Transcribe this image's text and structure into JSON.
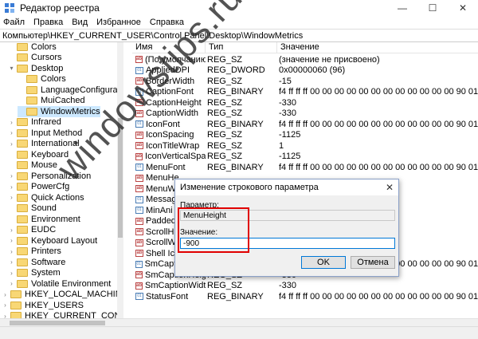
{
  "window": {
    "title": "Редактор реестра"
  },
  "menu": [
    "Файл",
    "Правка",
    "Вид",
    "Избранное",
    "Справка"
  ],
  "address": "Компьютер\\HKEY_CURRENT_USER\\Control Panel\\Desktop\\WindowMetrics",
  "tree": [
    {
      "label": "Colors",
      "level": 2,
      "twisty": ""
    },
    {
      "label": "Cursors",
      "level": 2,
      "twisty": ""
    },
    {
      "label": "Desktop",
      "level": 2,
      "twisty": "▾"
    },
    {
      "label": "Colors",
      "level": 3,
      "twisty": ""
    },
    {
      "label": "LanguageConfiguration",
      "level": 3,
      "twisty": ""
    },
    {
      "label": "MuiCached",
      "level": 3,
      "twisty": ""
    },
    {
      "label": "WindowMetrics",
      "level": 3,
      "twisty": "",
      "selected": true
    },
    {
      "label": "Infrared",
      "level": 2,
      "twisty": "›"
    },
    {
      "label": "Input Method",
      "level": 2,
      "twisty": "›"
    },
    {
      "label": "International",
      "level": 2,
      "twisty": "›"
    },
    {
      "label": "Keyboard",
      "level": 2,
      "twisty": ""
    },
    {
      "label": "Mouse",
      "level": 2,
      "twisty": ""
    },
    {
      "label": "Personalization",
      "level": 2,
      "twisty": "›"
    },
    {
      "label": "PowerCfg",
      "level": 2,
      "twisty": "›"
    },
    {
      "label": "Quick Actions",
      "level": 2,
      "twisty": "›"
    },
    {
      "label": "Sound",
      "level": 2,
      "twisty": ""
    },
    {
      "label": "Environment",
      "level": 1,
      "twisty": ""
    },
    {
      "label": "EUDC",
      "level": 1,
      "twisty": "›"
    },
    {
      "label": "Keyboard Layout",
      "level": 1,
      "twisty": "›"
    },
    {
      "label": "Printers",
      "level": 1,
      "twisty": "›"
    },
    {
      "label": "Software",
      "level": 1,
      "twisty": "›"
    },
    {
      "label": "System",
      "level": 1,
      "twisty": "›"
    },
    {
      "label": "Volatile Environment",
      "level": 1,
      "twisty": "›"
    },
    {
      "label": "HKEY_LOCAL_MACHINE",
      "level": 0,
      "twisty": "›"
    },
    {
      "label": "HKEY_USERS",
      "level": 0,
      "twisty": "›"
    },
    {
      "label": "HKEY_CURRENT_CONFIG",
      "level": 0,
      "twisty": "›"
    }
  ],
  "columns": {
    "name": "Имя",
    "type": "Тип",
    "value": "Значение"
  },
  "values": [
    {
      "name": "(По умолчанию)",
      "type": "REG_SZ",
      "value": "(значение не присвоено)",
      "icon": "ab"
    },
    {
      "name": "AppliedDPI",
      "type": "REG_DWORD",
      "value": "0x00000060 (96)",
      "icon": "bin"
    },
    {
      "name": "BorderWidth",
      "type": "REG_SZ",
      "value": "-15",
      "icon": "ab"
    },
    {
      "name": "CaptionFont",
      "type": "REG_BINARY",
      "value": "f4 ff ff ff 00 00 00 00 00 00 00 00 00 00 00 00 90 01 0...",
      "icon": "bin"
    },
    {
      "name": "CaptionHeight",
      "type": "REG_SZ",
      "value": "-330",
      "icon": "ab"
    },
    {
      "name": "CaptionWidth",
      "type": "REG_SZ",
      "value": "-330",
      "icon": "ab"
    },
    {
      "name": "IconFont",
      "type": "REG_BINARY",
      "value": "f4 ff ff ff 00 00 00 00 00 00 00 00 00 00 00 00 90 01 0...",
      "icon": "bin"
    },
    {
      "name": "IconSpacing",
      "type": "REG_SZ",
      "value": "-1125",
      "icon": "ab"
    },
    {
      "name": "IconTitleWrap",
      "type": "REG_SZ",
      "value": "1",
      "icon": "ab"
    },
    {
      "name": "IconVerticalSpac...",
      "type": "REG_SZ",
      "value": "-1125",
      "icon": "ab"
    },
    {
      "name": "MenuFont",
      "type": "REG_BINARY",
      "value": "f4 ff ff ff 00 00 00 00 00 00 00 00 00 00 00 00 90 01 0...",
      "icon": "bin"
    },
    {
      "name": "MenuHe",
      "type": "",
      "value": "",
      "icon": "ab"
    },
    {
      "name": "MenuWi",
      "type": "",
      "value": "",
      "icon": "ab"
    },
    {
      "name": "Messag",
      "type": "",
      "value": "00 00 00 00 90 01 0...",
      "icon": "bin"
    },
    {
      "name": "MinAni",
      "type": "",
      "value": "",
      "icon": "bin"
    },
    {
      "name": "PaddedB",
      "type": "",
      "value": "",
      "icon": "ab"
    },
    {
      "name": "ScrollHe",
      "type": "",
      "value": "",
      "icon": "ab"
    },
    {
      "name": "ScrollWi",
      "type": "",
      "value": "",
      "icon": "ab"
    },
    {
      "name": "Shell Ico",
      "type": "",
      "value": "",
      "icon": "ab"
    },
    {
      "name": "SmCaptionFont",
      "type": "REG_BINARY",
      "value": "f4 ff ff ff 00 00 00 00 00 00 00 00 00 00 00 00 90 01 0...",
      "icon": "bin"
    },
    {
      "name": "SmCaptionHeight",
      "type": "REG_SZ",
      "value": "-330",
      "icon": "ab"
    },
    {
      "name": "SmCaptionWidth",
      "type": "REG_SZ",
      "value": "-330",
      "icon": "ab"
    },
    {
      "name": "StatusFont",
      "type": "REG_BINARY",
      "value": "f4 ff ff ff 00 00 00 00 00 00 00 00 00 00 00 00 90 01 0...",
      "icon": "bin"
    }
  ],
  "dialog": {
    "title": "Изменение строкового параметра",
    "param_label": "Параметр:",
    "param_value": "MenuHeight",
    "value_label": "Значение:",
    "value_input": "-900",
    "ok": "OK",
    "cancel": "Отмена"
  },
  "watermark": "windowstips.ru"
}
